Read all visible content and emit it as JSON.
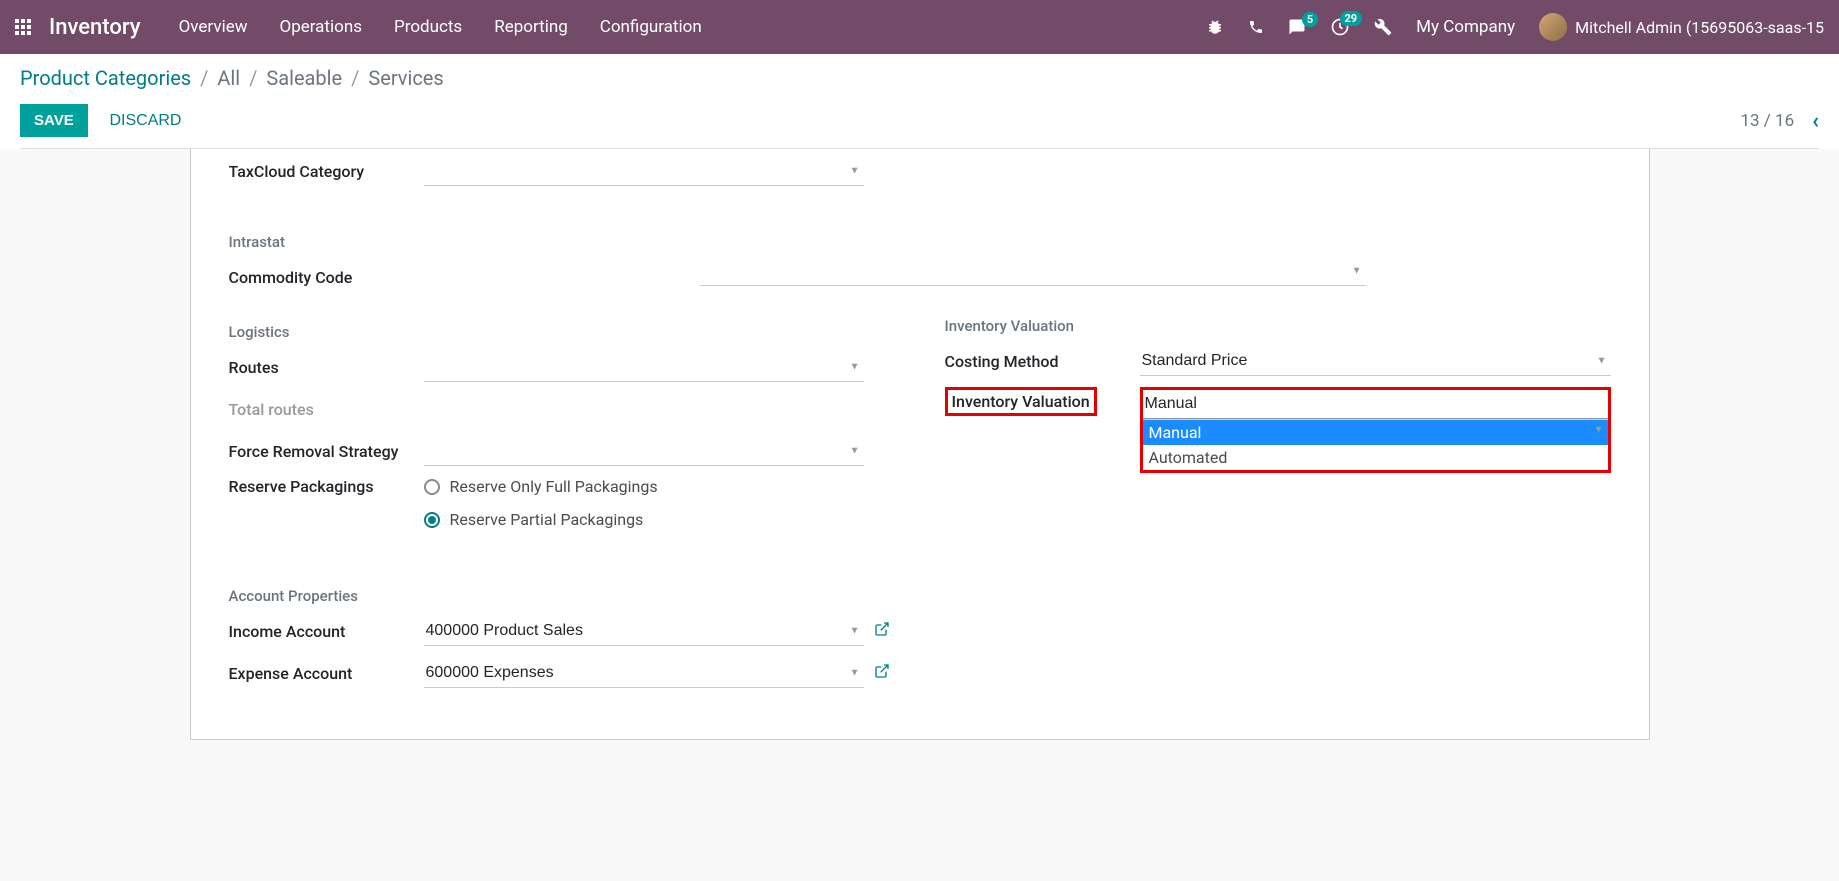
{
  "navbar": {
    "brand": "Inventory",
    "menu": [
      "Overview",
      "Operations",
      "Products",
      "Reporting",
      "Configuration"
    ],
    "chat_badge": "5",
    "activity_badge": "29",
    "company": "My Company",
    "user": "Mitchell Admin (15695063-saas-15"
  },
  "breadcrumbs": {
    "root": "Product Categories",
    "items": [
      "All",
      "Saleable",
      "Services"
    ]
  },
  "actions": {
    "save": "SAVE",
    "discard": "DISCARD"
  },
  "pager": {
    "current": "13",
    "total": "16"
  },
  "form": {
    "taxcloud_label": "TaxCloud Category",
    "intrastat_title": "Intrastat",
    "commodity_label": "Commodity Code",
    "logistics_title": "Logistics",
    "routes_label": "Routes",
    "total_routes_label": "Total routes",
    "force_removal_label": "Force Removal Strategy",
    "reserve_label": "Reserve Packagings",
    "reserve_opt1": "Reserve Only Full Packagings",
    "reserve_opt2": "Reserve Partial Packagings",
    "account_title": "Account Properties",
    "income_label": "Income Account",
    "income_value": "400000 Product Sales",
    "expense_label": "Expense Account",
    "expense_value": "600000 Expenses",
    "valuation_title": "Inventory Valuation",
    "costing_label": "Costing Method",
    "costing_value": "Standard Price",
    "inv_val_label": "Inventory Valuation",
    "inv_val_value": "Manual",
    "inv_val_options": {
      "opt1": "Manual",
      "opt2": "Automated"
    }
  }
}
